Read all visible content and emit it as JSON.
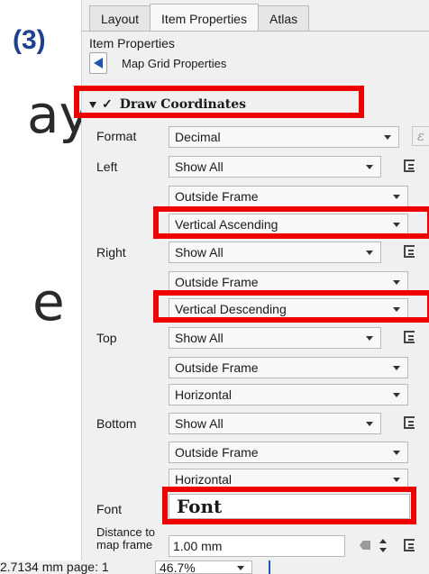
{
  "slide": {
    "step": "(3)",
    "fragment_1": "ay",
    "fragment_2": "e"
  },
  "tabs": [
    {
      "label": "Layout"
    },
    {
      "label": "Item Properties"
    },
    {
      "label": "Atlas"
    }
  ],
  "panel": {
    "title": "Item Properties",
    "subtitle": "Map Grid Properties",
    "back_icon": "left-triangle-icon",
    "section_label": "Draw Coordinates",
    "section_checked": true,
    "expression_symbol": "ε"
  },
  "fields": {
    "format_label": "Format",
    "format_value": "Decimal",
    "left_label": "Left",
    "left_display": "Show All",
    "left_position": "Outside Frame",
    "left_direction": "Vertical Ascending",
    "right_label": "Right",
    "right_display": "Show All",
    "right_position": "Outside Frame",
    "right_direction": "Vertical Descending",
    "top_label": "Top",
    "top_display": "Show All",
    "top_position": "Outside Frame",
    "top_direction": "Horizontal",
    "bottom_label": "Bottom",
    "bottom_display": "Show All",
    "bottom_position": "Outside Frame",
    "bottom_direction": "Horizontal",
    "font_label": "Font",
    "font_button": "Font",
    "distance_label_1": "Distance to",
    "distance_label_2": "map frame",
    "distance_value": "1.00 mm"
  },
  "status": {
    "coords": "2.7134 mm page: 1",
    "zoom": "46.7%"
  },
  "colors": {
    "highlight": "#ee0000",
    "accent": "#1f56b5",
    "step_label": "#1f3f8f"
  }
}
